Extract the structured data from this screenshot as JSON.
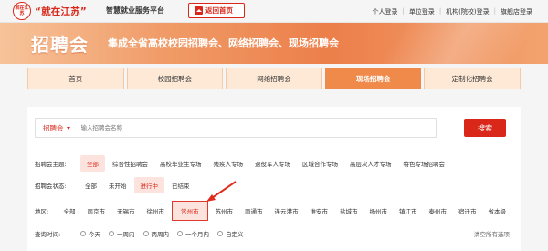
{
  "header": {
    "logo_text": "就在江苏",
    "brand": "“就在江苏”",
    "platform": "智慧就业服务平台",
    "home_button": "返回首页",
    "user_links": [
      "个人登录",
      "单位登录",
      "机构(院校)登录",
      "旗舰店登录"
    ]
  },
  "banner": {
    "title": "招聘会",
    "subtitle": "集成全省高校校园招聘会、网络招聘会、现场招聘会"
  },
  "nav": {
    "items": [
      {
        "label": "首页",
        "active": false
      },
      {
        "label": "校园招聘会",
        "active": false
      },
      {
        "label": "网络招聘会",
        "active": false
      },
      {
        "label": "现场招聘会",
        "active": true
      },
      {
        "label": "定制化招聘会",
        "active": false
      }
    ]
  },
  "search": {
    "type": "招聘会",
    "placeholder": "输入招聘会名称",
    "button": "搜索"
  },
  "filters": {
    "theme": {
      "label": "招聘会主题:",
      "options": [
        "全部",
        "综合性招聘会",
        "高校毕业生专场",
        "残疾人专场",
        "退役军人专场",
        "区域合作专场",
        "高层次人才专场",
        "特色专场招聘会"
      ],
      "selected": "全部"
    },
    "status": {
      "label": "招聘会状态:",
      "options": [
        "全部",
        "未开始",
        "进行中",
        "已结束"
      ],
      "selected": "进行中"
    },
    "region": {
      "label": "地区:",
      "options": [
        "全部",
        "南京市",
        "无锡市",
        "徐州市",
        "常州市",
        "苏州市",
        "南通市",
        "连云港市",
        "淮安市",
        "盐城市",
        "扬州市",
        "镇江市",
        "泰州市",
        "宿迁市",
        "省本级"
      ],
      "selected": "常州市"
    },
    "time": {
      "label": "查询时间:",
      "options": [
        "今天",
        "一周内",
        "两周内",
        "一个月内",
        "自定义"
      ]
    },
    "clear_all": "清空所有选项"
  },
  "colors": {
    "brand_red": "#d9281a",
    "nav_active": "#f08a4b",
    "nav_bg": "#fde9d6",
    "selected_bg": "#fde3dd"
  }
}
